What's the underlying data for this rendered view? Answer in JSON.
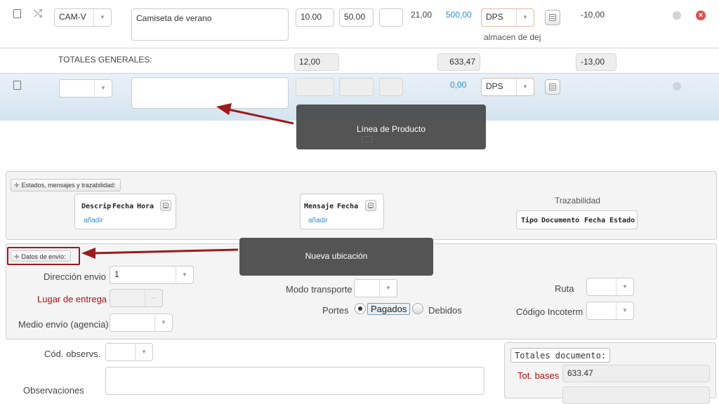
{
  "row1": {
    "code": "CAM-V",
    "description": "Camiseta de verano",
    "quantity": "10.00",
    "price": "50.00",
    "discount": "",
    "tax": "21,00",
    "total": "500,00",
    "warehouse_code": "DPS",
    "warehouse_name": "almacen de dej",
    "margin": "-10,00"
  },
  "totals": {
    "label": "TOTALES GENERALES:",
    "quantity": "12,00",
    "amount": "633,47",
    "margin": "-13,00"
  },
  "new_row": {
    "total": "0,00",
    "warehouse_code": "DPS"
  },
  "tooltip_product": "Línea de Producto",
  "tooltip_location": "Nueva ubicación",
  "estados": {
    "button_label": "Estados, mensajes y trazabilidad:",
    "box1_headers": [
      "Descrip",
      "Fecha",
      "Hora"
    ],
    "box1_add": "añadir",
    "box2_headers": [
      "Mensaje",
      "Fecha"
    ],
    "box2_add": "añadir",
    "traz_title": "Trazabilidad",
    "traz_headers": [
      "Tipo",
      "Documento",
      "Fecha",
      "Estado"
    ]
  },
  "envio": {
    "button_label": "Datos de envío:",
    "direccion_label": "Dirección envio",
    "direccion_value": "1",
    "lugar_label": "Lugar de entrega",
    "medio_label": "Medio envío (agencia)",
    "modo_label": "Modo transporte",
    "portes_label": "Portes",
    "pagados": "Pagados",
    "debidos": "Debidos",
    "ruta_label": "Ruta",
    "incoterm_label": "Código Incoterm"
  },
  "obs": {
    "cod_label": "Cód. observs.",
    "obs_label": "Observaciones"
  },
  "totales_doc": {
    "title": "Totales documento:",
    "bases_label": "Tot. bases",
    "bases_value": "633.47"
  },
  "colors": {
    "accent_blue": "#2a8fd6",
    "label_red": "#b10f0f",
    "arrow_red": "#9c1a1a",
    "row_highlight": "#dde9f3"
  }
}
